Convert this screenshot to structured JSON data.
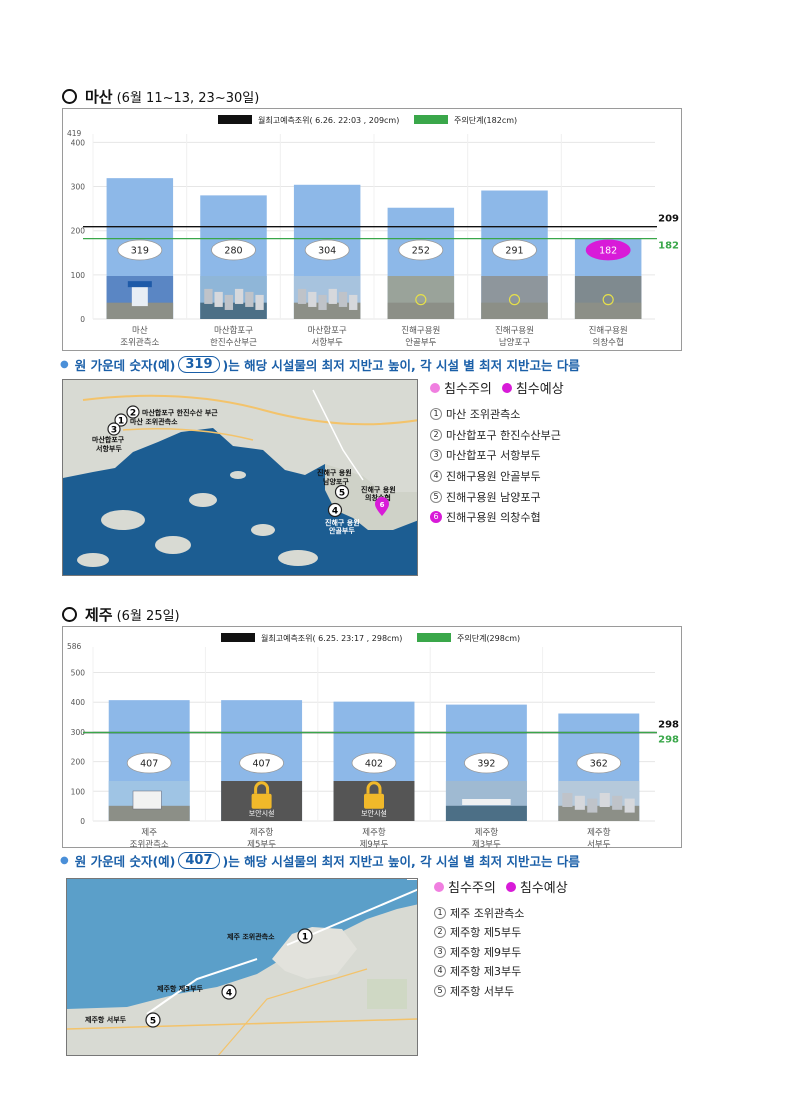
{
  "colors": {
    "bar": "#8db8e8",
    "black_line": "#111111",
    "green_line": "#3aa74a",
    "magenta": "#d81bd8",
    "pink": "#f07fe0",
    "note_blue": "#1a5fa8",
    "sea": "#1c5d92",
    "land": "#d8dad3"
  },
  "section1": {
    "title": "마산",
    "subtitle": "(6월 11~13, 23~30일)",
    "note": {
      "prefix": "원 가운데 숫자(예)",
      "example": "319",
      "suffix": ")는 해당 시설물의 최저 지반고 높이, 각 시설 별 최저 지반고는 다름"
    },
    "legend": {
      "caution": "침수주의",
      "expected": "침수예상",
      "items": [
        {
          "num": "1",
          "label": "마산 조위관측소",
          "highlight": false
        },
        {
          "num": "2",
          "label": "마산합포구 한진수산부근",
          "highlight": false
        },
        {
          "num": "3",
          "label": "마산합포구 서항부두",
          "highlight": false
        },
        {
          "num": "4",
          "label": "진해구용원 안골부두",
          "highlight": false
        },
        {
          "num": "5",
          "label": "진해구용원 남양포구",
          "highlight": false
        },
        {
          "num": "6",
          "label": "진해구용원 의창수협",
          "highlight": true
        }
      ]
    },
    "map_labels": {
      "l1": "마산 조위관측소",
      "l2": "마산합포구 한진수산 부근",
      "l3a": "마산합포구",
      "l3b": "서항부두",
      "l4a": "진해구 용원",
      "l4b": "안골부두",
      "l5a": "진해구 용원",
      "l5b": "남양포구",
      "l6a": "진해구 용원",
      "l6b": "의창수협",
      "n1": "1",
      "n2": "2",
      "n3": "3",
      "n4": "4",
      "n5": "5",
      "n6": "6"
    }
  },
  "section2": {
    "title": "제주",
    "subtitle": "(6월 25일)",
    "note": {
      "prefix": "원 가운데 숫자(예)",
      "example": "407",
      "suffix": ")는 해당 시설물의 최저 지반고 높이, 각 시설 별 최저 지반고는 다름"
    },
    "legend": {
      "caution": "침수주의",
      "expected": "침수예상",
      "items": [
        {
          "num": "1",
          "label": "제주 조위관측소"
        },
        {
          "num": "2",
          "label": "제주항 제5부두"
        },
        {
          "num": "3",
          "label": "제주항 제9부두"
        },
        {
          "num": "4",
          "label": "제주항 제3부두"
        },
        {
          "num": "5",
          "label": "제주항 서부두"
        }
      ]
    },
    "map_labels": {
      "l1": "제주 조위관측소",
      "l4": "제주항 제3부두",
      "l5": "제주항 서부두",
      "n1": "1",
      "n4": "4",
      "n5": "5"
    }
  },
  "chart_data": [
    {
      "type": "bar",
      "legend": [
        "월최고예측조위( 6.26. 22:03 , 209cm)",
        "주의단계(182cm)"
      ],
      "categories": [
        [
          "마산",
          "조위관측소"
        ],
        [
          "마산합포구",
          "한진수산부근"
        ],
        [
          "마산합포구",
          "서항부두"
        ],
        [
          "진해구용원",
          "안골부두"
        ],
        [
          "진해구용원",
          "남양포구"
        ],
        [
          "진해구용원",
          "의창수협"
        ]
      ],
      "values": [
        319,
        280,
        304,
        252,
        291,
        182
      ],
      "value_labels": [
        "319",
        "280",
        "304",
        "252",
        "291",
        "182"
      ],
      "highlight_index": 5,
      "y_ticks": [
        "0",
        "100",
        "200",
        "300",
        "400"
      ],
      "y_top_label": "419",
      "ylim": [
        0,
        419
      ],
      "lines": [
        {
          "name": "predicted",
          "value": 209,
          "label": "209",
          "color": "#111111"
        },
        {
          "name": "caution",
          "value": 182,
          "label": "182",
          "color": "#3aa74a"
        }
      ],
      "photo_kinds": [
        "tower",
        "harbor",
        "city",
        "construction",
        "lot",
        "dock"
      ]
    },
    {
      "type": "bar",
      "legend": [
        "월최고예측조위( 6.25. 23:17 , 298cm)",
        "주의단계(298cm)"
      ],
      "categories": [
        [
          "제주",
          "조위관측소"
        ],
        [
          "제주항",
          "제5부두"
        ],
        [
          "제주항",
          "제9부두"
        ],
        [
          "제주항",
          "제3부두"
        ],
        [
          "제주항",
          "서부두"
        ]
      ],
      "values": [
        407,
        407,
        402,
        392,
        362
      ],
      "value_labels": [
        "407",
        "407",
        "402",
        "392",
        "362"
      ],
      "highlight_index": -1,
      "y_ticks": [
        "0",
        "100",
        "200",
        "300",
        "400",
        "500"
      ],
      "y_top_label": "586",
      "ylim": [
        0,
        586
      ],
      "lines": [
        {
          "name": "predicted",
          "value": 298,
          "label": "298",
          "color": "#111111"
        },
        {
          "name": "caution",
          "value": 298,
          "label": "298",
          "color": "#3aa74a"
        }
      ],
      "photo_kinds": [
        "station",
        "lock",
        "lock",
        "ship",
        "port"
      ],
      "lock_label": "보안시설"
    }
  ]
}
